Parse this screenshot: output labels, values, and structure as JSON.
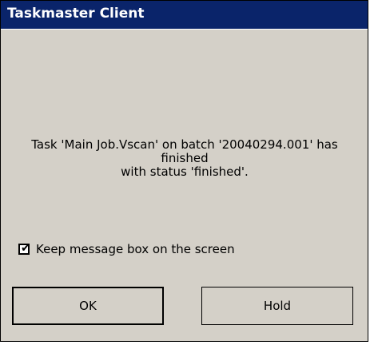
{
  "window": {
    "title": "Taskmaster Client",
    "colors": {
      "titlebar": "#0a246a",
      "face": "#d4d0c8"
    }
  },
  "message": {
    "line1": "Task 'Main Job.Vscan' on batch '20040294.001' has",
    "line2": "finished",
    "line3": "with status 'finished'."
  },
  "keep_checkbox": {
    "label": "Keep message box on the screen",
    "checked": true,
    "check_glyph": "✔"
  },
  "buttons": {
    "ok_label": "OK",
    "hold_label": "Hold"
  }
}
